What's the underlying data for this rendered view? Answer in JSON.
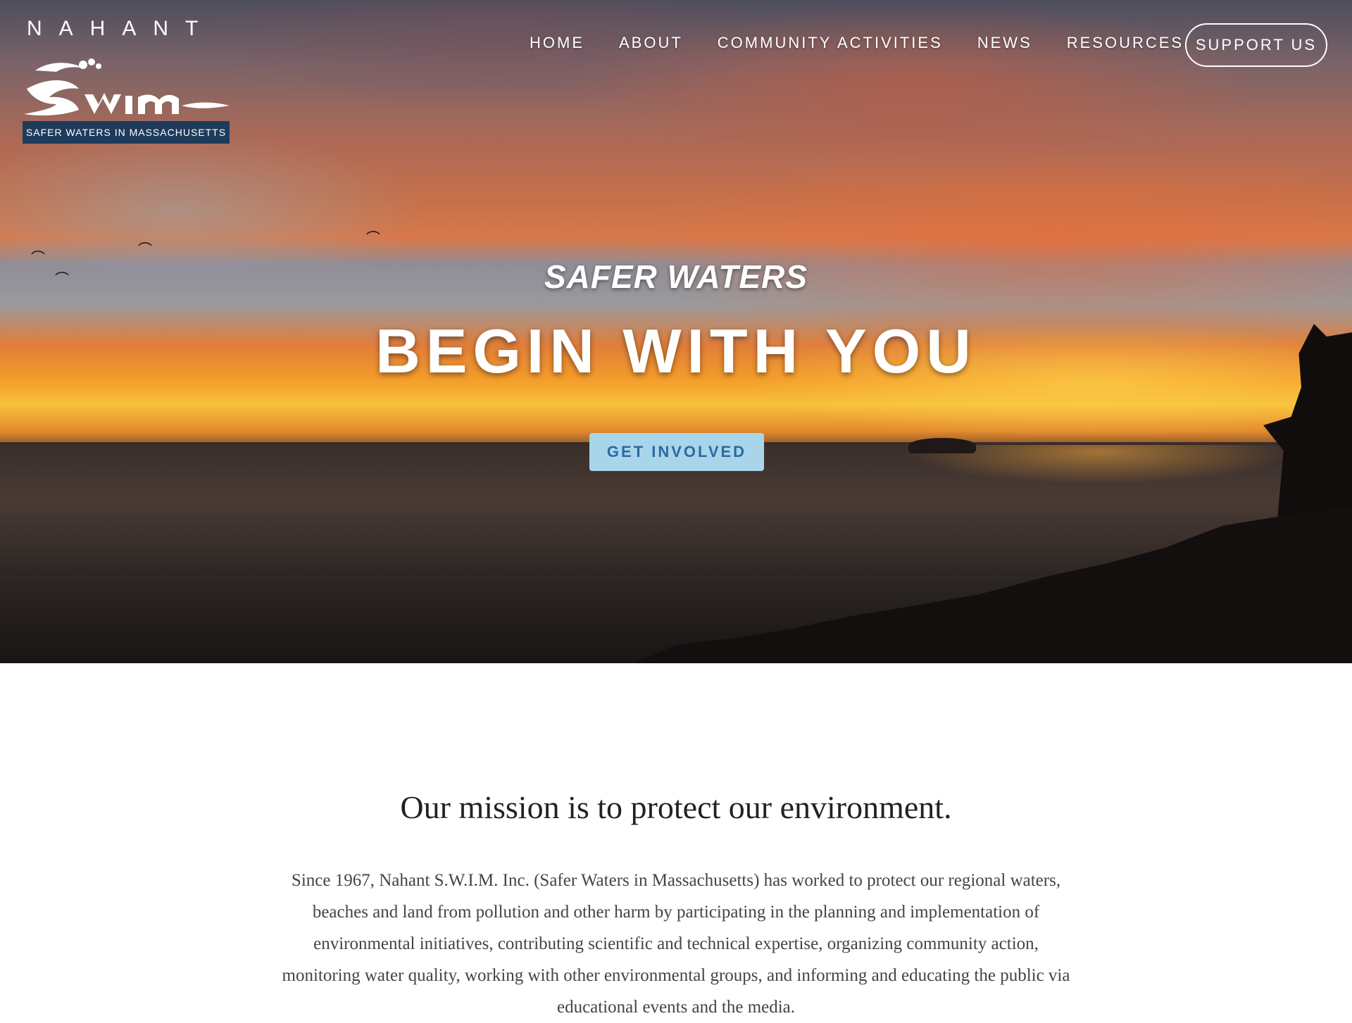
{
  "header": {
    "brand_wordmark": "NAHANT",
    "logo_name": "SWIM",
    "logo_tagline": "SAFER WATERS IN MASSACHUSETTS",
    "nav": [
      {
        "label": "HOME"
      },
      {
        "label": "ABOUT"
      },
      {
        "label": "COMMUNITY ACTIVITIES"
      },
      {
        "label": "NEWS"
      },
      {
        "label": "RESOURCES"
      }
    ],
    "support_label": "SUPPORT US"
  },
  "hero": {
    "kicker": "SAFER WATERS",
    "headline": "BEGIN WITH YOU",
    "cta_label": "GET INVOLVED",
    "background": "sunset-over-ocean"
  },
  "mission": {
    "title": "Our mission is to protect our environment.",
    "body": "Since 1967, Nahant S.W.I.M. Inc. (Safer Waters in Massachusetts) has worked to protect our regional waters, beaches and land from pollution and other harm by participating in the planning and implementation of environmental initiatives, contributing scientific and technical expertise, organizing community action, monitoring water quality, working with other environmental groups, and informing and educating the public via educational events and the media."
  },
  "colors": {
    "cta_bg": "#a9d5ea",
    "cta_text": "#2b6aa3",
    "tagline_bg": "#1f3b5b",
    "page_bg": "#ffffff"
  }
}
